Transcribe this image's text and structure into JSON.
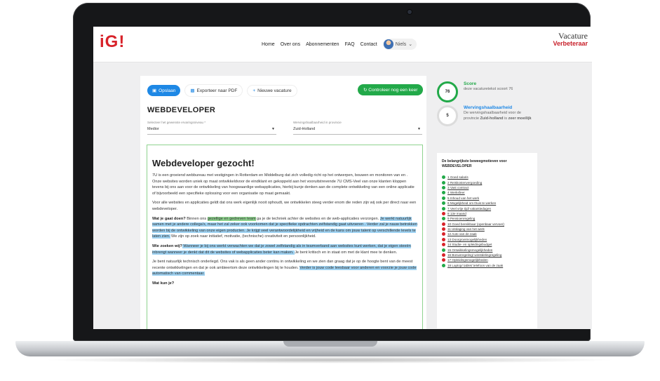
{
  "header": {
    "logo": "iG!",
    "nav": [
      "Home",
      "Over ons",
      "Abonnementen",
      "FAQ",
      "Contact"
    ],
    "user_name": "Niels",
    "brand_line1": "Vacature",
    "brand_line2": "Verbeteraar"
  },
  "toolbar": {
    "save_label": "Opslaan",
    "export_label": "Exporteer naar PDF",
    "new_label": "Nieuwe vacature",
    "check_label": "Controleer nog een keer"
  },
  "job": {
    "title": "WEBDEVELOPER",
    "level_label": "Selecteer het gewenste ervaringsniveau *",
    "level_value": "Medior",
    "province_label": "Wervingshaalbaarheid in provincie",
    "province_value": "Zuid-Holland"
  },
  "editor": {
    "heading": "Webdeveloper gezocht!",
    "p1": "7U is een groeiend webbureau met vestigingen in Rotterdam en Middelburg dat zich volledig richt op het ontwerpen, bouwen en monitoren van en . Onze websites worden uniek op maat ontwikkeldvoor de eindklant en gekoppeld aan het vooruitstrevende 7U CMS-Veel van onze klanten kloppen tevens bij ons aan voor de ontwikkeling van hoogwaardige webapplicaties, hierbij kunje denken aan de complete ontwikkeling van een online applicatie of bijvoorbeeld een specifieke oplossing voor een organisatie op maat gemaakt.",
    "p2": "Voor alle websites en applicaties geldt dat ons werk eigenlijk nooit ophoudt, we ontwikkelen steeg verder enom die reden zijn wij ook per direct naar een webdeveloper.",
    "p3_lead": "Wat je gaat doen?",
    "p3_a": " Binnen ons ",
    "p3_hl_green": "gezellige en gedreven team",
    "p3_b": " ga je de techniek achter de websites en de web-applicaties verzorgen. ",
    "p3_hl_blue": "Je werkt natuurlijk samen met je andere collega's, maar het zal zeker ook voorkomen dat je specifieke opdrachten zelfstandig gaat uitvoeren .  Verder zal je nauw betrokken worden bij de ontwikkeling van onze eigen producten.  Je krijgt veel verantwoordelijkheid en vrijheid en de kans om jouw talent op verschillende levels te laten zien.",
    "p3_c": "  We zijn op zoek naar initiatief, motivatie, (technische) creativiteit en persoonlijkheid.",
    "p4_lead": "Wie zoeken wij?",
    "p4_hl_blue": " Wanneer je bij ons werkt verwachten we dat je zowel zelfstandig als in teamverband aan websites kunt werken, dat je eigen steeën inbrengt wanneer je denkt dat dit de websites of webapplicaties beter kan maken. ",
    "p4_b": " Je bent kritisch en in staat om met de klant mee te denken.",
    "p5_a": "Je bent natuurlijk technisch onderlegd. Ons vak is als geen ander continu in ontwikkeling en we zien dan graag dat je op de hoogte bent van de meest recente ontwikkelingen en dat je ook ambieertom deze ontwikkelingen bij te houden. ",
    "p5_hl_blue": "Verder is jouw code leesbaar voor anderen en voorzie je jouw code automatisch van commentaar.",
    "p6_lead": "Wat kun je?"
  },
  "scores": {
    "score_value": "76",
    "score_title": "Score",
    "score_desc": "deze vacaturetekst scoort 76",
    "werving_value": "5",
    "werving_title": "Wervingshaalbaarheid",
    "werving_desc_a": "De wervingshaalbaarheid voor de provincie ",
    "werving_province": "Zuid-holland",
    "werving_desc_b": " is ",
    "werving_level": "zeer moeilijk"
  },
  "card": {
    "title": "De belangrijkste beweegmotieven voor WEBDEVELOPER",
    "items": [
      {
        "label": "1 Goed salaris",
        "status": "green"
      },
      {
        "label": "2 Reiskostenvergoeding",
        "status": "green"
      },
      {
        "label": "3 Vast contract",
        "status": "green"
      },
      {
        "label": "4 Werksfeer",
        "status": "green"
      },
      {
        "label": "5 Inhoud van het werk",
        "status": "green"
      },
      {
        "label": "6 Mogelijkheid om thuis te werken",
        "status": "green"
      },
      {
        "label": "7 Veel vrije tijd/ vakantiedagen",
        "status": "green"
      },
      {
        "label": "8 13e maand",
        "status": "red"
      },
      {
        "label": "9 Pensioenregeling",
        "status": "green"
      },
      {
        "label": "10 Goed bereikbaar (openbaar vervoer)",
        "status": "red"
      },
      {
        "label": "11 Uitdaging van het werk",
        "status": "red"
      },
      {
        "label": "12 Auto van de zaak",
        "status": "red"
      },
      {
        "label": "13 Doorgroeimogelijkheden",
        "status": "red"
      },
      {
        "label": "14 Studie- en opleidingsbudget",
        "status": "red"
      },
      {
        "label": "15 Ontwikkelingsmogelijkheden",
        "status": "green"
      },
      {
        "label": "16 Bonusregeling/ winstdelingregeling",
        "status": "red"
      },
      {
        "label": "17 Opleidingsmogelijkheden",
        "status": "red"
      },
      {
        "label": "18 Laptop/ tablet/ telefoon van de zaak",
        "status": "green"
      }
    ]
  },
  "colors": {
    "accent_red": "#d8232a",
    "accent_green": "#22a949",
    "accent_blue": "#1e88e5"
  }
}
